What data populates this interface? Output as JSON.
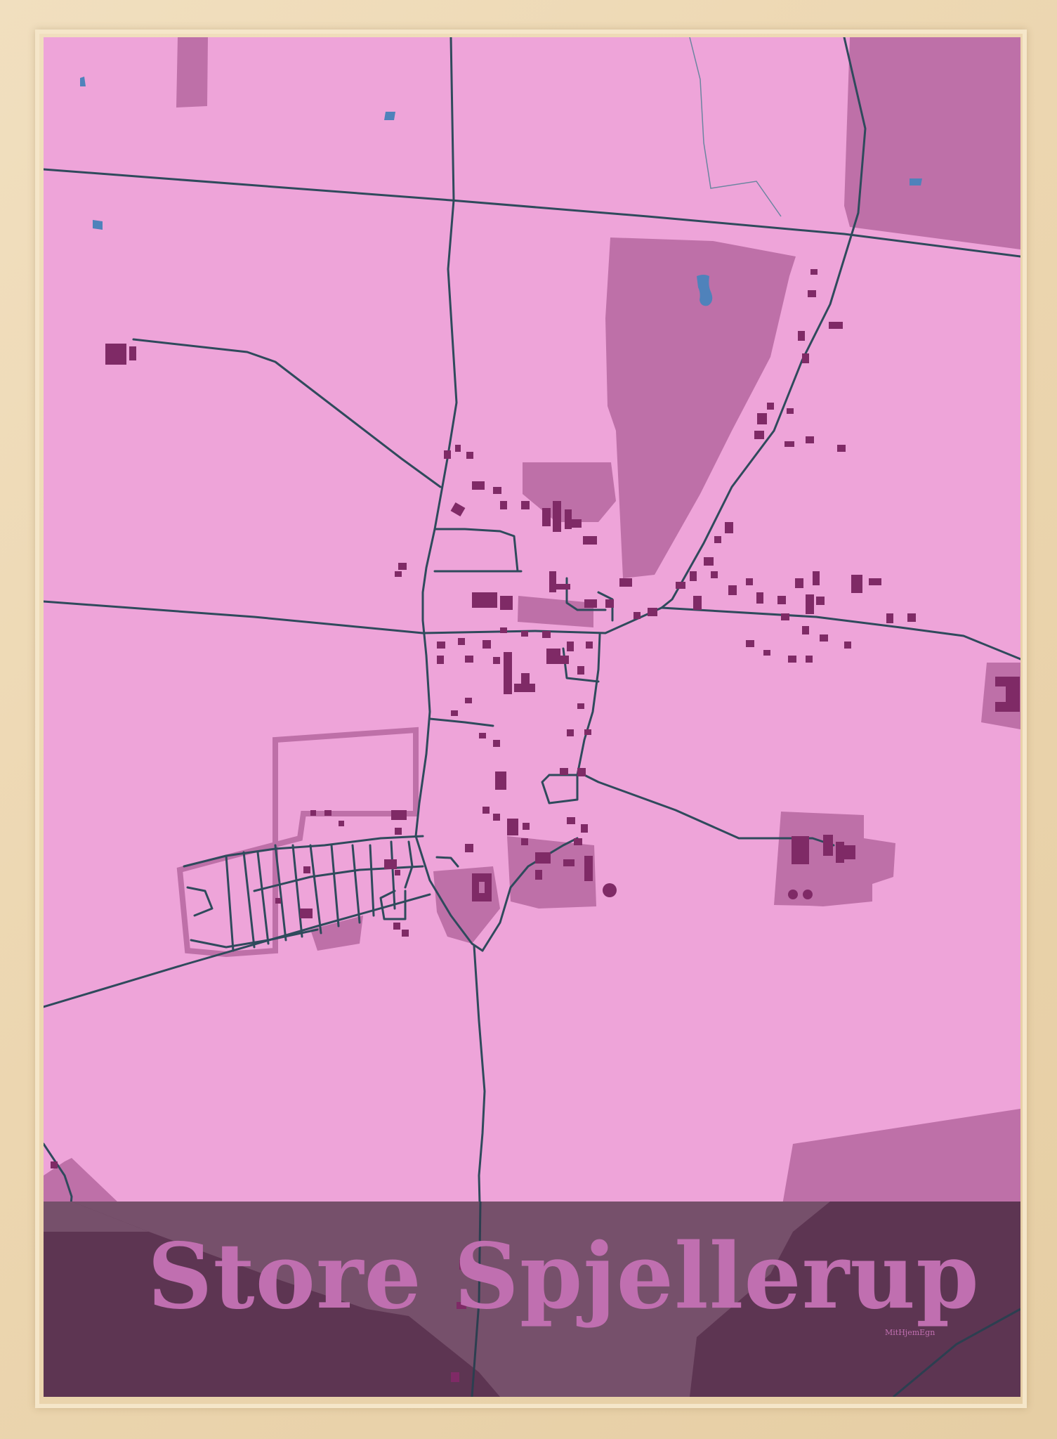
{
  "poster": {
    "title": "Store Spjellerup",
    "signature": "MitHjemEgn"
  },
  "colors": {
    "frame": "#ecd6b0",
    "land": "#eea4d9",
    "area": "#be70a8",
    "building": "#7f2a66",
    "road": "#2f4a5c",
    "water": "#4f82bb",
    "band_dark": "#5d3552",
    "band_mid": "#76506b",
    "title": "#c06fb0"
  },
  "icons": {
    "water": "water-pond-icon",
    "building": "building-icon"
  }
}
